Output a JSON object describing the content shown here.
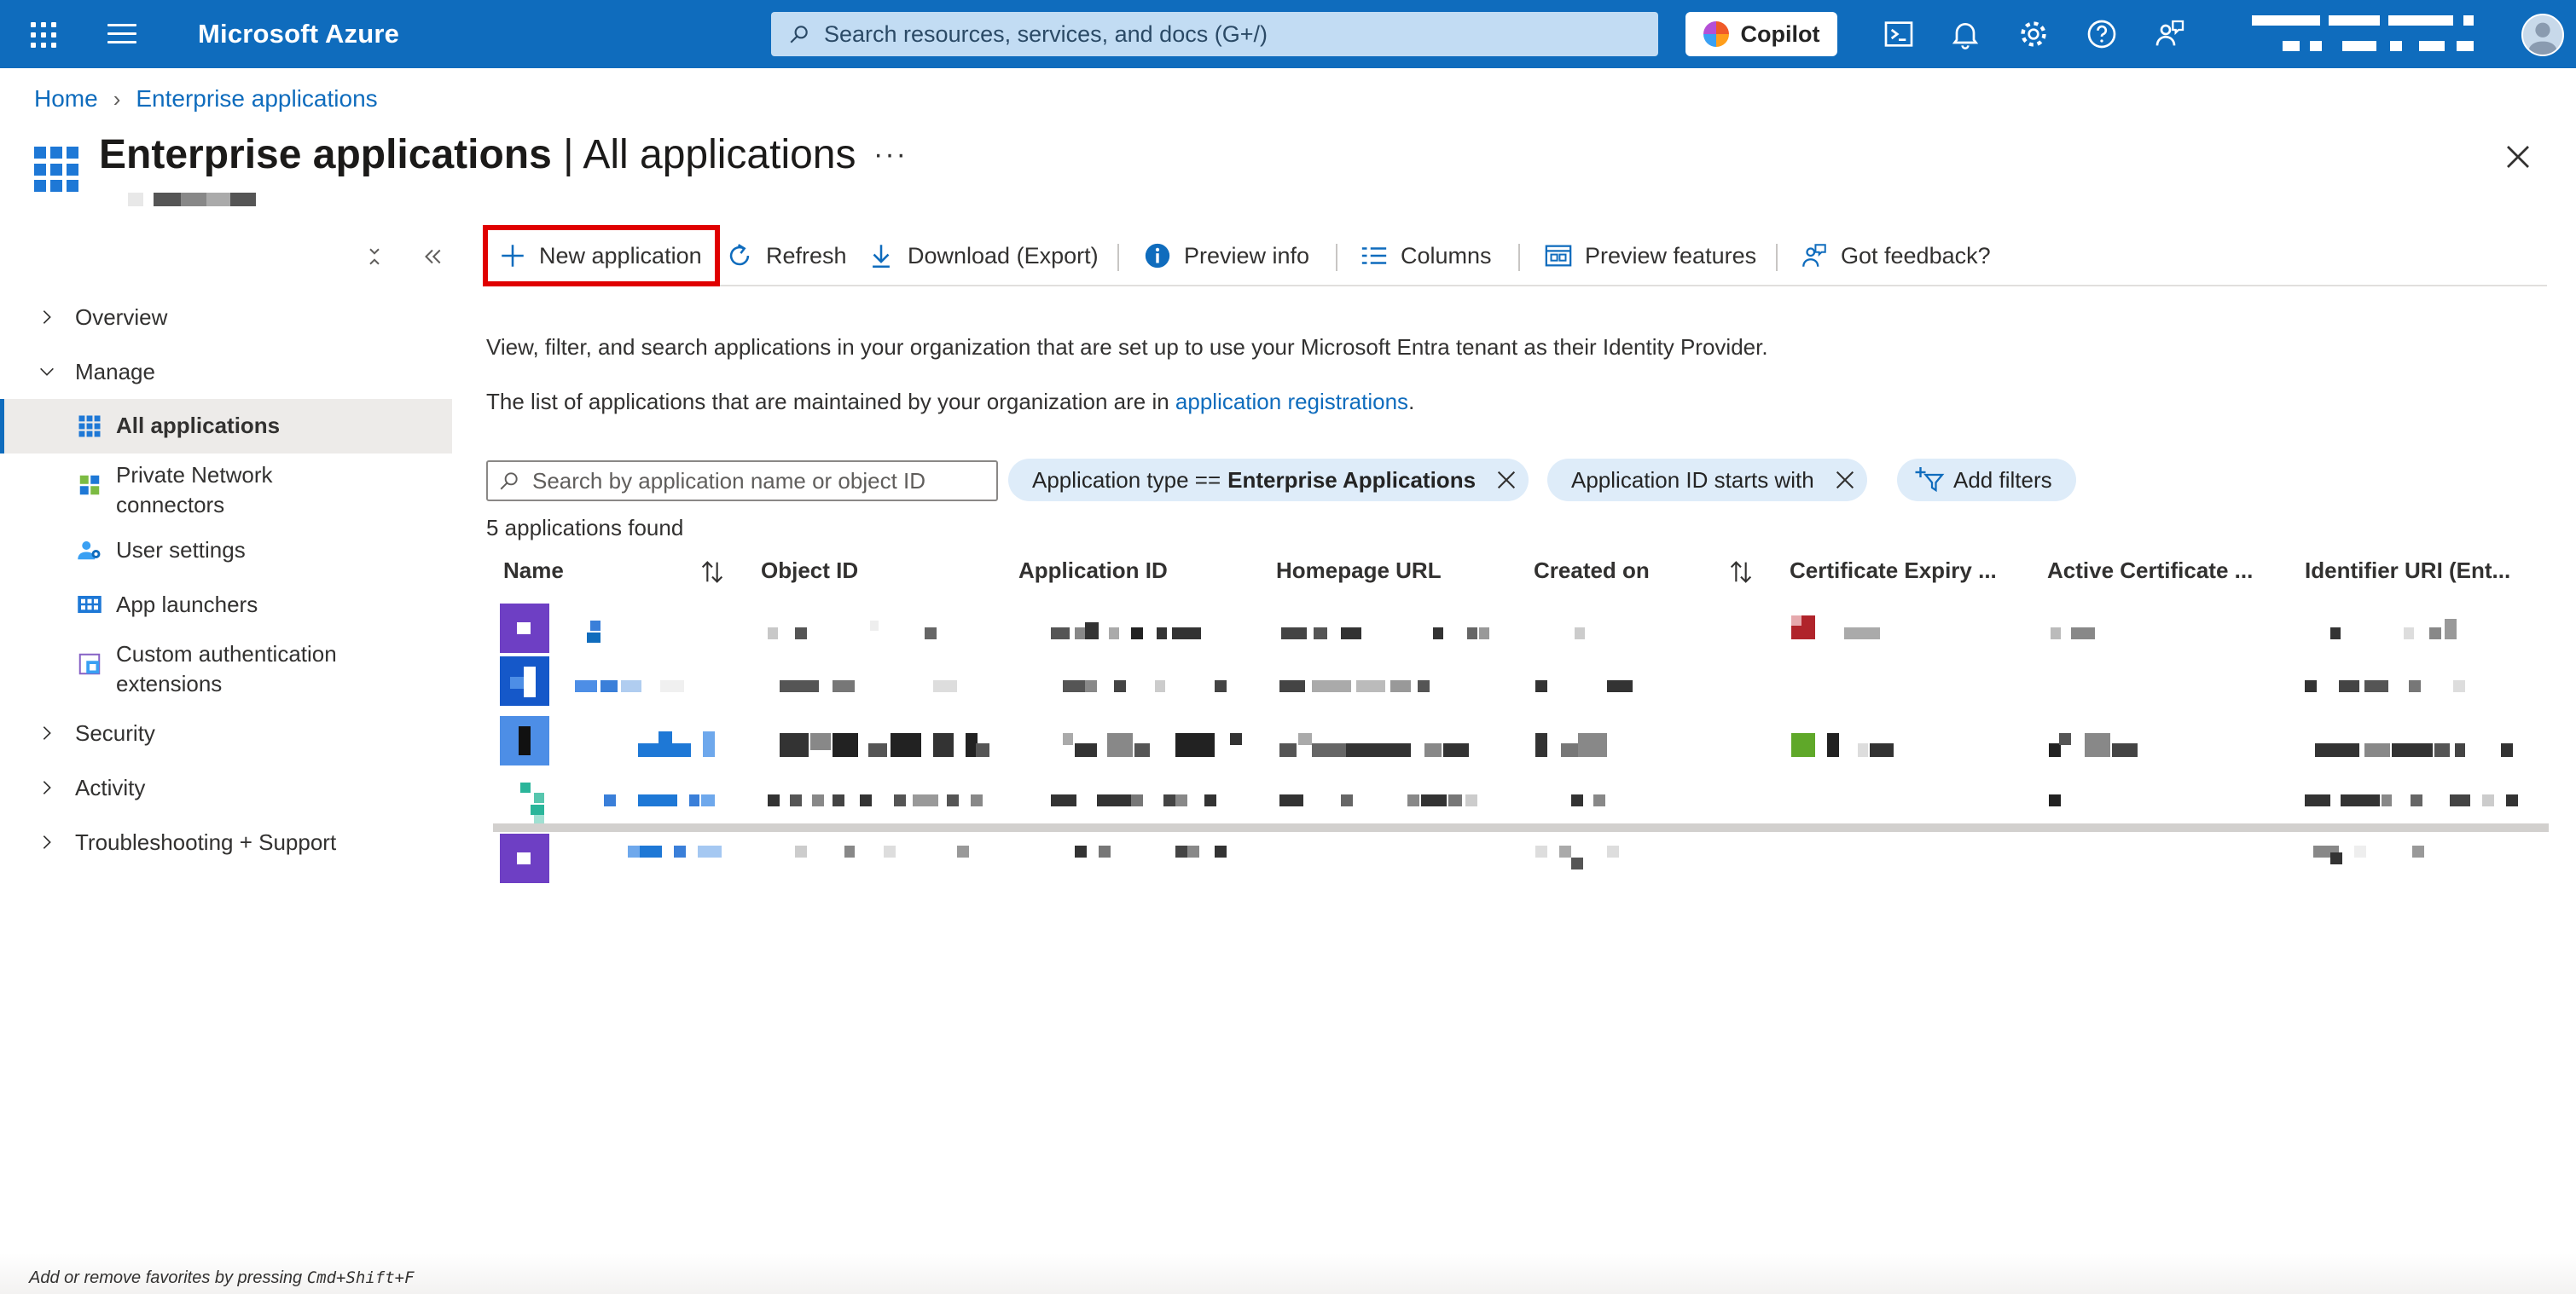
{
  "topbar": {
    "brand": "Microsoft Azure",
    "search_placeholder": "Search resources, services, and docs (G+/)",
    "copilot_label": "Copilot",
    "icons": [
      "waffle-icon",
      "hamburger-icon",
      "cloud-shell-icon",
      "bell-icon",
      "gear-icon",
      "help-icon",
      "feedback-icon",
      "avatar"
    ]
  },
  "breadcrumb": {
    "home": "Home",
    "current": "Enterprise applications"
  },
  "header": {
    "title_bold": "Enterprise applications",
    "title_sep": " | ",
    "title_sub": "All applications",
    "more": "···"
  },
  "nav": {
    "overview": "Overview",
    "manage": "Manage",
    "all_applications": "All applications",
    "private_network_1": "Private Network",
    "private_network_2": "connectors",
    "user_settings": "User settings",
    "app_launchers": "App launchers",
    "custom_auth_1": "Custom authentication",
    "custom_auth_2": "extensions",
    "security": "Security",
    "activity": "Activity",
    "troubleshooting": "Troubleshooting + Support"
  },
  "toolbar": {
    "new_application": "New application",
    "refresh": "Refresh",
    "download": "Download (Export)",
    "preview_info": "Preview info",
    "columns": "Columns",
    "preview_features": "Preview features",
    "feedback": "Got feedback?"
  },
  "content": {
    "description": "View, filter, and search applications in your organization that are set up to use your Microsoft Entra tenant as their Identity Provider.",
    "list_text": "The list of applications that are maintained by your organization are in ",
    "list_link": "application registrations",
    "list_end": ".",
    "search_placeholder": "Search by application name or object ID",
    "filter1_label": "Application type ==",
    "filter1_value": "Enterprise Applications",
    "filter2_label": "Application ID starts with",
    "add_filters": "Add filters",
    "count": "5 applications found"
  },
  "grid": {
    "columns": [
      "Name",
      "Object ID",
      "Application ID",
      "Homepage URL",
      "Created on",
      "Certificate Expiry ...",
      "Active Certificate ...",
      "Identifier URI (Ent..."
    ]
  },
  "colors": {
    "accent": "#0f6cbd",
    "highlight": "#e00000",
    "pill": "#deecf9"
  },
  "footer": {
    "hint_prefix": "Add or remove favorites by pressing ",
    "hint_keys": "Cmd+Shift+F"
  }
}
